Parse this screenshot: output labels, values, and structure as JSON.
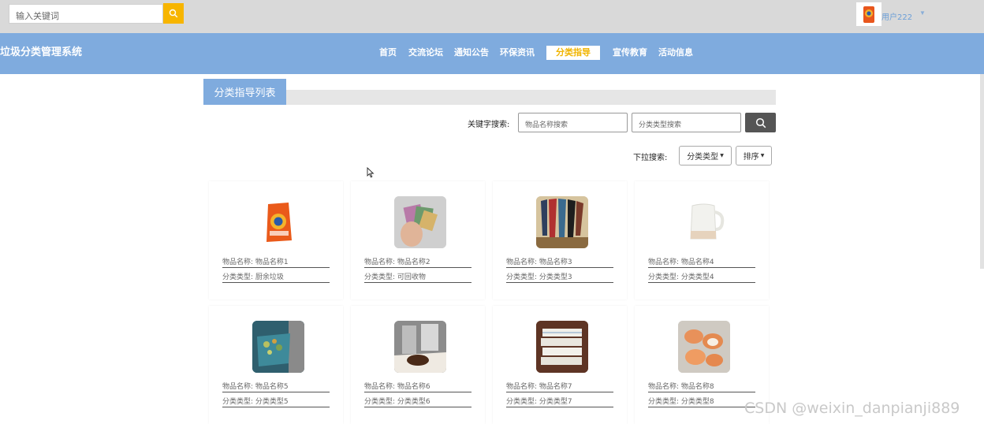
{
  "header": {
    "search_placeholder": "输入关键词",
    "user_name": "用户222",
    "accent_color": "#f7b500"
  },
  "nav": {
    "site_title": "垃圾分类管理系统",
    "items": [
      {
        "label": "首页"
      },
      {
        "label": "交流论坛"
      },
      {
        "label": "通知公告"
      },
      {
        "label": "环保资讯"
      },
      {
        "label": "分类指导"
      },
      {
        "label": "宣传教育"
      },
      {
        "label": "活动信息"
      }
    ],
    "active_index": 4,
    "bar_color": "#7fabde"
  },
  "list": {
    "title": "分类指导列表",
    "keyword_label": "关键字搜索:",
    "name_placeholder": "物品名称搜索",
    "type_placeholder": "分类类型搜索",
    "dropdown_label": "下拉搜索:",
    "type_dropdown": "分类类型",
    "sort_dropdown": "排序"
  },
  "items": [
    {
      "name_label": "物品名称:",
      "name": "物品名称1",
      "type_label": "分类类型:",
      "type": "厨余垃圾",
      "image": "detergent-bag"
    },
    {
      "name_label": "物品名称:",
      "name": "物品名称2",
      "type_label": "分类类型:",
      "type": "可回收物",
      "image": "fabric-swatches"
    },
    {
      "name_label": "物品名称:",
      "name": "物品名称3",
      "type_label": "分类类型:",
      "type": "分类类型3",
      "image": "umbrellas"
    },
    {
      "name_label": "物品名称:",
      "name": "物品名称4",
      "type_label": "分类类型:",
      "type": "分类类型4",
      "image": "kettle"
    },
    {
      "name_label": "物品名称:",
      "name": "物品名称5",
      "type_label": "分类类型:",
      "type": "分类类型5",
      "image": "food-waste-bin"
    },
    {
      "name_label": "物品名称:",
      "name": "物品名称6",
      "type_label": "分类类型:",
      "type": "分类类型6",
      "image": "coffee-grounds"
    },
    {
      "name_label": "物品名称:",
      "name": "物品名称7",
      "type_label": "分类类型:",
      "type": "分类类型7",
      "image": "folded-towels"
    },
    {
      "name_label": "物品名称:",
      "name": "物品名称8",
      "type_label": "分类类型:",
      "type": "分类类型8",
      "image": "eggshells"
    }
  ],
  "watermark": "CSDN @weixin_danpianji889"
}
